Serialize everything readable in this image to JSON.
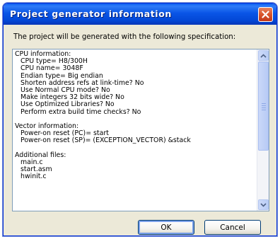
{
  "window": {
    "title": "Project generator information",
    "close_icon": "close-icon"
  },
  "message": "The project will be generated with the following specification:",
  "spec_lines": [
    {
      "text": "CPU information:",
      "indent": false
    },
    {
      "text": "CPU type= H8/300H",
      "indent": true
    },
    {
      "text": "CPU name= 3048F",
      "indent": true
    },
    {
      "text": "Endian type= Big endian",
      "indent": true
    },
    {
      "text": "Shorten address refs at link-time? No",
      "indent": true
    },
    {
      "text": "Use Normal CPU mode? No",
      "indent": true
    },
    {
      "text": "Make integers 32 bits wide? No",
      "indent": true
    },
    {
      "text": "Use Optimized Libraries? No",
      "indent": true
    },
    {
      "text": "Perform extra build time checks? No",
      "indent": true
    },
    {
      "text": "",
      "indent": false
    },
    {
      "text": "Vector information:",
      "indent": false
    },
    {
      "text": "Power-on reset (PC)= start",
      "indent": true
    },
    {
      "text": "Power-on reset (SP)= (EXCEPTION_VECTOR) &stack",
      "indent": true
    },
    {
      "text": "",
      "indent": false
    },
    {
      "text": "Additional files:",
      "indent": false
    },
    {
      "text": "main.c",
      "indent": true
    },
    {
      "text": "start.asm",
      "indent": true
    },
    {
      "text": "hwinit.c",
      "indent": true
    },
    {
      "text": "",
      "indent": false
    },
    {
      "text": "",
      "indent": false
    }
  ],
  "scrollbar": {
    "up_icon": "chevron-up-icon",
    "down_icon": "chevron-down-icon"
  },
  "buttons": {
    "ok_label": "OK",
    "cancel_label": "Cancel"
  }
}
